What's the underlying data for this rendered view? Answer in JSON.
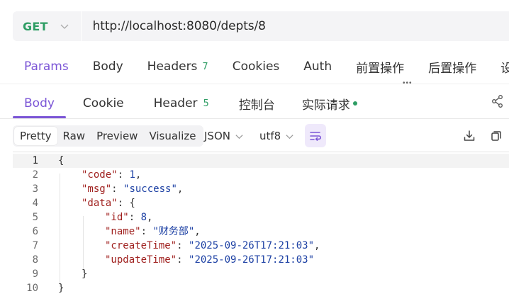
{
  "request": {
    "method": "GET",
    "url": "http://localhost:8080/depts/8"
  },
  "request_tabs": [
    {
      "label": "Params",
      "active": true
    },
    {
      "label": "Body"
    },
    {
      "label": "Headers",
      "count": "7"
    },
    {
      "label": "Cookies"
    },
    {
      "label": "Auth"
    },
    {
      "label": "前置操作"
    },
    {
      "label": "后置操作"
    },
    {
      "label": "设"
    }
  ],
  "response_tabs": [
    {
      "label": "Body",
      "active": true
    },
    {
      "label": "Cookie"
    },
    {
      "label": "Header",
      "count": "5"
    },
    {
      "label": "控制台"
    },
    {
      "label": "实际请求"
    }
  ],
  "toolbar": {
    "views": [
      "Pretty",
      "Raw",
      "Preview",
      "Visualize"
    ],
    "format": "JSON",
    "encoding": "utf8"
  },
  "code_lines": [
    {
      "n": "1",
      "indent": 0,
      "parts": [
        [
          "punc",
          "{"
        ]
      ]
    },
    {
      "n": "2",
      "indent": 1,
      "parts": [
        [
          "key",
          "\"code\""
        ],
        [
          "punc",
          ": "
        ],
        [
          "num",
          "1"
        ],
        [
          "punc",
          ","
        ]
      ]
    },
    {
      "n": "3",
      "indent": 1,
      "parts": [
        [
          "key",
          "\"msg\""
        ],
        [
          "punc",
          ": "
        ],
        [
          "str",
          "\"success\""
        ],
        [
          "punc",
          ","
        ]
      ]
    },
    {
      "n": "4",
      "indent": 1,
      "parts": [
        [
          "key",
          "\"data\""
        ],
        [
          "punc",
          ": {"
        ]
      ]
    },
    {
      "n": "5",
      "indent": 2,
      "parts": [
        [
          "key",
          "\"id\""
        ],
        [
          "punc",
          ": "
        ],
        [
          "num",
          "8"
        ],
        [
          "punc",
          ","
        ]
      ]
    },
    {
      "n": "6",
      "indent": 2,
      "parts": [
        [
          "key",
          "\"name\""
        ],
        [
          "punc",
          ": "
        ],
        [
          "str",
          "\"财务部\""
        ],
        [
          "punc",
          ","
        ]
      ]
    },
    {
      "n": "7",
      "indent": 2,
      "parts": [
        [
          "key",
          "\"createTime\""
        ],
        [
          "punc",
          ": "
        ],
        [
          "str",
          "\"2025-09-26T17:21:03\""
        ],
        [
          "punc",
          ","
        ]
      ]
    },
    {
      "n": "8",
      "indent": 2,
      "parts": [
        [
          "key",
          "\"updateTime\""
        ],
        [
          "punc",
          ": "
        ],
        [
          "str",
          "\"2025-09-26T17:21:03\""
        ]
      ]
    },
    {
      "n": "9",
      "indent": 1,
      "parts": [
        [
          "punc",
          "}"
        ]
      ]
    },
    {
      "n": "10",
      "indent": 0,
      "parts": [
        [
          "punc",
          "}"
        ]
      ]
    }
  ],
  "colors": {
    "accent": "#7b55d6",
    "method_get": "#2e9d64",
    "json_key": "#a0211f",
    "json_value": "#1b3fa3"
  }
}
